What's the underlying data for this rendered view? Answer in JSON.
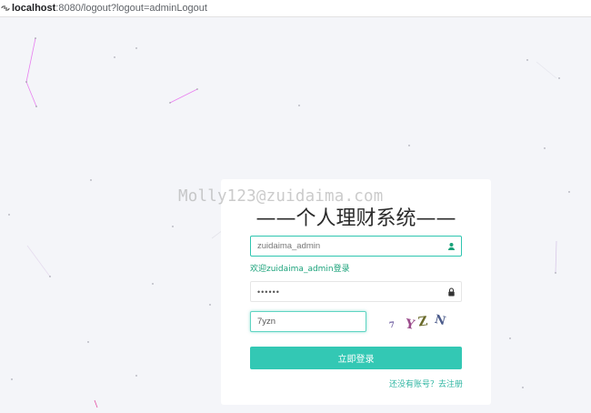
{
  "browser": {
    "url_host": "localhost",
    "url_rest": ":8080/logout?logout=adminLogout"
  },
  "watermark": "Molly123@zuidaima.com",
  "login": {
    "title": "——个人理财系统——",
    "username_value": "zuidaima_admin",
    "welcome_text": "欢迎zuidaima_admin登录",
    "password_mask": "••••••",
    "captcha_value": "7yzn",
    "captcha_chars": [
      "7",
      "Y",
      "Z",
      "N"
    ],
    "submit_label": "立即登录",
    "register_text": "还没有账号？去注册"
  },
  "colors": {
    "accent": "#33c8b4",
    "welcome": "#1aa27a",
    "background": "#f4f5f9"
  }
}
